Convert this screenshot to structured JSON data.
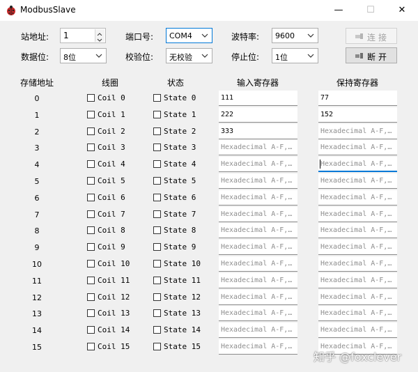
{
  "window": {
    "title": "ModbusSlave",
    "minimize": "—",
    "maximize": "☐",
    "close": "✕"
  },
  "config": {
    "station_label": "站地址:",
    "station_value": "1",
    "port_label": "端口号:",
    "port_value": "COM4",
    "baud_label": "波特率:",
    "baud_value": "9600",
    "databits_label": "数据位:",
    "databits_value": "8位",
    "parity_label": "校验位:",
    "parity_value": "无校验",
    "stopbits_label": "停止位:",
    "stopbits_value": "1位",
    "connect_label": "连接",
    "disconnect_label": "断开"
  },
  "headers": {
    "address": "存储地址",
    "coil": "线圈",
    "state": "状态",
    "input_reg": "输入寄存器",
    "holding_reg": "保持寄存器"
  },
  "placeholder": "Hexadecimal A-F,…",
  "rows": [
    {
      "addr": "0",
      "coil": "Coil 0",
      "state": "State 0",
      "input": "111",
      "holding": "77"
    },
    {
      "addr": "1",
      "coil": "Coil 1",
      "state": "State 1",
      "input": "222",
      "holding": "152"
    },
    {
      "addr": "2",
      "coil": "Coil 2",
      "state": "State 2",
      "input": "333",
      "holding": ""
    },
    {
      "addr": "3",
      "coil": "Coil 3",
      "state": "State 3",
      "input": "",
      "holding": ""
    },
    {
      "addr": "4",
      "coil": "Coil 4",
      "state": "State 4",
      "input": "",
      "holding": ""
    },
    {
      "addr": "5",
      "coil": "Coil 5",
      "state": "State 5",
      "input": "",
      "holding": ""
    },
    {
      "addr": "6",
      "coil": "Coil 6",
      "state": "State 6",
      "input": "",
      "holding": ""
    },
    {
      "addr": "7",
      "coil": "Coil 7",
      "state": "State 7",
      "input": "",
      "holding": ""
    },
    {
      "addr": "8",
      "coil": "Coil 8",
      "state": "State 8",
      "input": "",
      "holding": ""
    },
    {
      "addr": "9",
      "coil": "Coil 9",
      "state": "State 9",
      "input": "",
      "holding": ""
    },
    {
      "addr": "10",
      "coil": "Coil 10",
      "state": "State 10",
      "input": "",
      "holding": ""
    },
    {
      "addr": "11",
      "coil": "Coil 11",
      "state": "State 11",
      "input": "",
      "holding": ""
    },
    {
      "addr": "12",
      "coil": "Coil 12",
      "state": "State 12",
      "input": "",
      "holding": ""
    },
    {
      "addr": "13",
      "coil": "Coil 13",
      "state": "State 13",
      "input": "",
      "holding": ""
    },
    {
      "addr": "14",
      "coil": "Coil 14",
      "state": "State 14",
      "input": "",
      "holding": ""
    },
    {
      "addr": "15",
      "coil": "Coil 15",
      "state": "State 15",
      "input": "",
      "holding": ""
    }
  ],
  "focused_row": 4,
  "watermark": "知乎 @foxclever",
  "colors": {
    "accent": "#0078d7",
    "placeholder": "#8e8e8e",
    "window_bg": "#f0f0f0"
  },
  "icons": {
    "app": "ladybug-icon",
    "connect": "plug-icon",
    "disconnect": "unplug-icon"
  }
}
